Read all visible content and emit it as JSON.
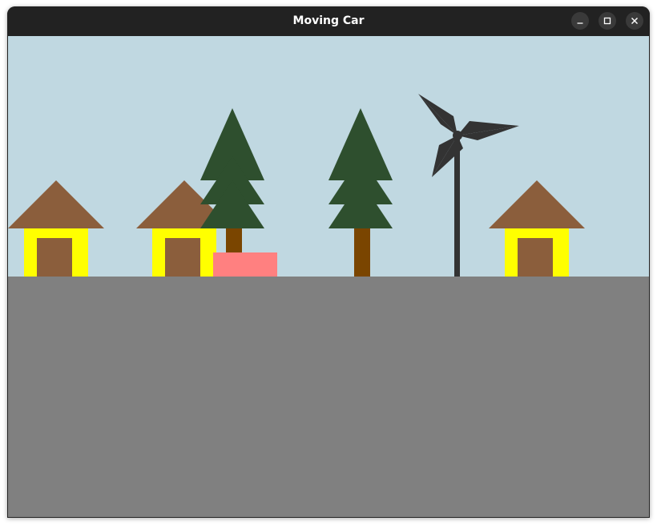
{
  "window": {
    "title": "Moving Car",
    "controls": [
      "minimize-icon",
      "maximize-icon",
      "close-icon"
    ]
  },
  "scene": {
    "colors": {
      "sky": "#c0d8e1",
      "ground": "#808080",
      "roof": "#8b5e3c",
      "house_wall": "#ffff00",
      "door": "#8b5e3c",
      "tree_foliage": "#2e4f2e",
      "tree_trunk": "#7a4500",
      "car": "#ff8080",
      "windmill": "#333333"
    }
  }
}
